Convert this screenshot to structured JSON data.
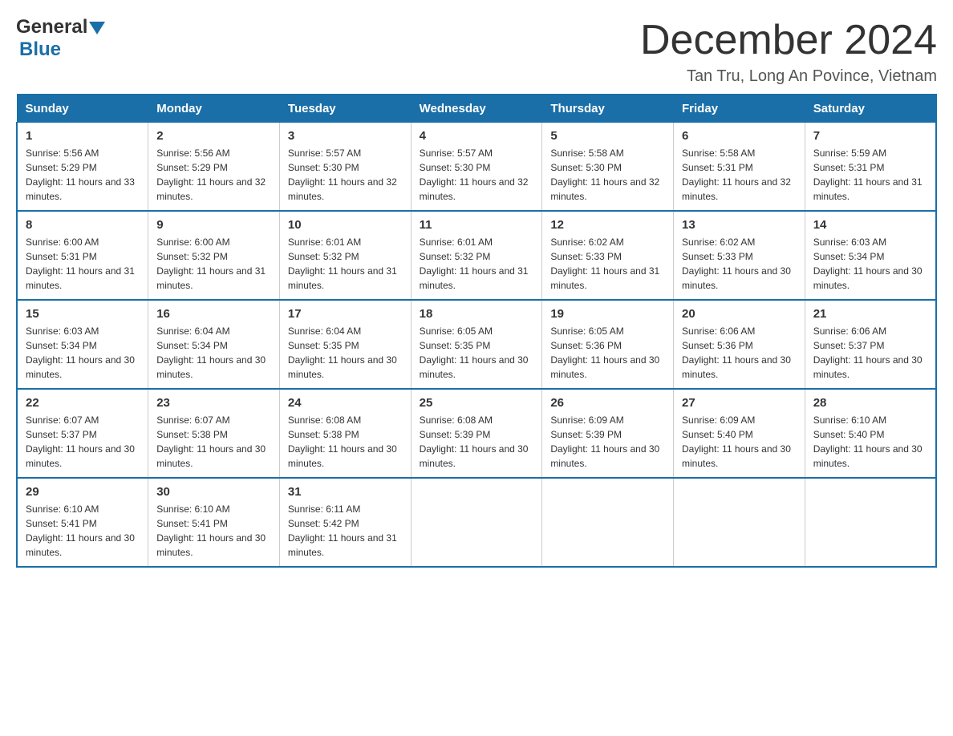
{
  "header": {
    "logo_text_general": "General",
    "logo_text_blue": "Blue",
    "title": "December 2024",
    "subtitle": "Tan Tru, Long An Povince, Vietnam"
  },
  "days_of_week": [
    "Sunday",
    "Monday",
    "Tuesday",
    "Wednesday",
    "Thursday",
    "Friday",
    "Saturday"
  ],
  "weeks": [
    [
      {
        "day": "1",
        "sunrise": "5:56 AM",
        "sunset": "5:29 PM",
        "daylight": "11 hours and 33 minutes."
      },
      {
        "day": "2",
        "sunrise": "5:56 AM",
        "sunset": "5:29 PM",
        "daylight": "11 hours and 32 minutes."
      },
      {
        "day": "3",
        "sunrise": "5:57 AM",
        "sunset": "5:30 PM",
        "daylight": "11 hours and 32 minutes."
      },
      {
        "day": "4",
        "sunrise": "5:57 AM",
        "sunset": "5:30 PM",
        "daylight": "11 hours and 32 minutes."
      },
      {
        "day": "5",
        "sunrise": "5:58 AM",
        "sunset": "5:30 PM",
        "daylight": "11 hours and 32 minutes."
      },
      {
        "day": "6",
        "sunrise": "5:58 AM",
        "sunset": "5:31 PM",
        "daylight": "11 hours and 32 minutes."
      },
      {
        "day": "7",
        "sunrise": "5:59 AM",
        "sunset": "5:31 PM",
        "daylight": "11 hours and 31 minutes."
      }
    ],
    [
      {
        "day": "8",
        "sunrise": "6:00 AM",
        "sunset": "5:31 PM",
        "daylight": "11 hours and 31 minutes."
      },
      {
        "day": "9",
        "sunrise": "6:00 AM",
        "sunset": "5:32 PM",
        "daylight": "11 hours and 31 minutes."
      },
      {
        "day": "10",
        "sunrise": "6:01 AM",
        "sunset": "5:32 PM",
        "daylight": "11 hours and 31 minutes."
      },
      {
        "day": "11",
        "sunrise": "6:01 AM",
        "sunset": "5:32 PM",
        "daylight": "11 hours and 31 minutes."
      },
      {
        "day": "12",
        "sunrise": "6:02 AM",
        "sunset": "5:33 PM",
        "daylight": "11 hours and 31 minutes."
      },
      {
        "day": "13",
        "sunrise": "6:02 AM",
        "sunset": "5:33 PM",
        "daylight": "11 hours and 30 minutes."
      },
      {
        "day": "14",
        "sunrise": "6:03 AM",
        "sunset": "5:34 PM",
        "daylight": "11 hours and 30 minutes."
      }
    ],
    [
      {
        "day": "15",
        "sunrise": "6:03 AM",
        "sunset": "5:34 PM",
        "daylight": "11 hours and 30 minutes."
      },
      {
        "day": "16",
        "sunrise": "6:04 AM",
        "sunset": "5:34 PM",
        "daylight": "11 hours and 30 minutes."
      },
      {
        "day": "17",
        "sunrise": "6:04 AM",
        "sunset": "5:35 PM",
        "daylight": "11 hours and 30 minutes."
      },
      {
        "day": "18",
        "sunrise": "6:05 AM",
        "sunset": "5:35 PM",
        "daylight": "11 hours and 30 minutes."
      },
      {
        "day": "19",
        "sunrise": "6:05 AM",
        "sunset": "5:36 PM",
        "daylight": "11 hours and 30 minutes."
      },
      {
        "day": "20",
        "sunrise": "6:06 AM",
        "sunset": "5:36 PM",
        "daylight": "11 hours and 30 minutes."
      },
      {
        "day": "21",
        "sunrise": "6:06 AM",
        "sunset": "5:37 PM",
        "daylight": "11 hours and 30 minutes."
      }
    ],
    [
      {
        "day": "22",
        "sunrise": "6:07 AM",
        "sunset": "5:37 PM",
        "daylight": "11 hours and 30 minutes."
      },
      {
        "day": "23",
        "sunrise": "6:07 AM",
        "sunset": "5:38 PM",
        "daylight": "11 hours and 30 minutes."
      },
      {
        "day": "24",
        "sunrise": "6:08 AM",
        "sunset": "5:38 PM",
        "daylight": "11 hours and 30 minutes."
      },
      {
        "day": "25",
        "sunrise": "6:08 AM",
        "sunset": "5:39 PM",
        "daylight": "11 hours and 30 minutes."
      },
      {
        "day": "26",
        "sunrise": "6:09 AM",
        "sunset": "5:39 PM",
        "daylight": "11 hours and 30 minutes."
      },
      {
        "day": "27",
        "sunrise": "6:09 AM",
        "sunset": "5:40 PM",
        "daylight": "11 hours and 30 minutes."
      },
      {
        "day": "28",
        "sunrise": "6:10 AM",
        "sunset": "5:40 PM",
        "daylight": "11 hours and 30 minutes."
      }
    ],
    [
      {
        "day": "29",
        "sunrise": "6:10 AM",
        "sunset": "5:41 PM",
        "daylight": "11 hours and 30 minutes."
      },
      {
        "day": "30",
        "sunrise": "6:10 AM",
        "sunset": "5:41 PM",
        "daylight": "11 hours and 30 minutes."
      },
      {
        "day": "31",
        "sunrise": "6:11 AM",
        "sunset": "5:42 PM",
        "daylight": "11 hours and 31 minutes."
      },
      null,
      null,
      null,
      null
    ]
  ]
}
